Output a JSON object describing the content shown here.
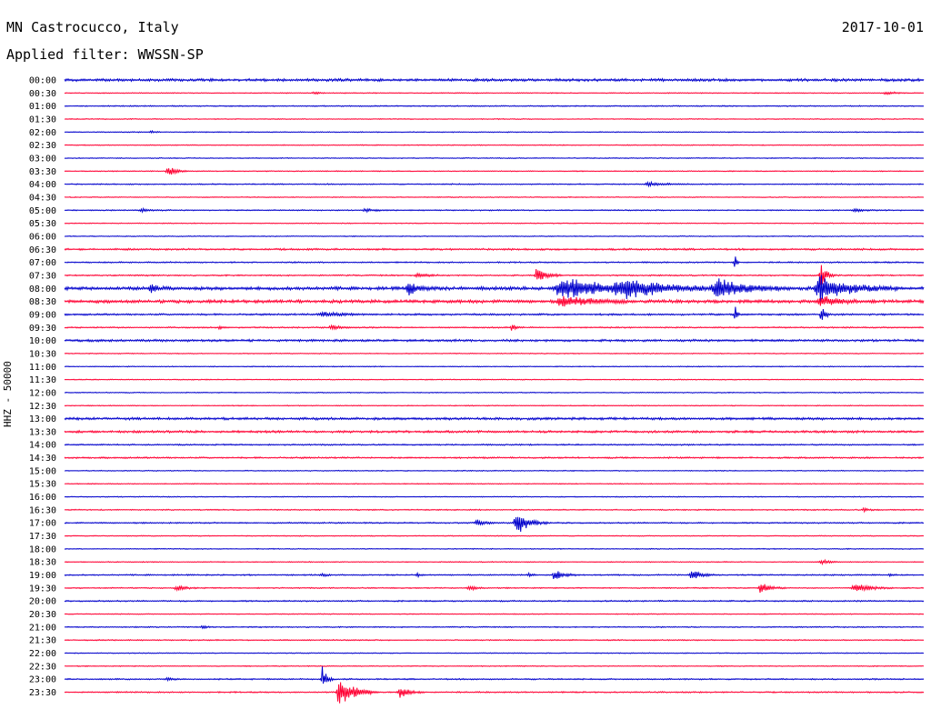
{
  "header": {
    "station": "MN Castrocucco, Italy",
    "date": "2017-10-01",
    "filter": "Applied filter: WWSSN-SP"
  },
  "chart_data": {
    "type": "line",
    "ylabel": "HHZ - 50000",
    "colors": [
      "#0000cc",
      "#ff0033"
    ],
    "rows": [
      {
        "label": "00:00",
        "noise": 1.2,
        "events": []
      },
      {
        "label": "00:30",
        "noise": 0.4,
        "events": [
          {
            "x": 0.29,
            "amp": 1.5,
            "dur": 0.005
          },
          {
            "x": 0.955,
            "amp": 2,
            "dur": 0.01
          }
        ]
      },
      {
        "label": "01:00",
        "noise": 0.5,
        "events": []
      },
      {
        "label": "01:30",
        "noise": 0.4,
        "events": []
      },
      {
        "label": "02:00",
        "noise": 0.4,
        "events": [
          {
            "x": 0.1,
            "amp": 2,
            "dur": 0.004
          }
        ]
      },
      {
        "label": "02:30",
        "noise": 0.4,
        "events": []
      },
      {
        "label": "03:00",
        "noise": 0.4,
        "events": []
      },
      {
        "label": "03:30",
        "noise": 0.4,
        "events": [
          {
            "x": 0.12,
            "amp": 6,
            "dur": 0.008
          }
        ]
      },
      {
        "label": "04:00",
        "noise": 0.5,
        "events": [
          {
            "x": 0.68,
            "amp": 2,
            "dur": 0.02
          }
        ]
      },
      {
        "label": "04:30",
        "noise": 0.4,
        "events": []
      },
      {
        "label": "05:00",
        "noise": 0.5,
        "events": [
          {
            "x": 0.09,
            "amp": 2,
            "dur": 0.01
          },
          {
            "x": 0.35,
            "amp": 2,
            "dur": 0.01
          },
          {
            "x": 0.92,
            "amp": 2,
            "dur": 0.01
          }
        ]
      },
      {
        "label": "05:30",
        "noise": 0.4,
        "events": []
      },
      {
        "label": "06:00",
        "noise": 0.4,
        "events": []
      },
      {
        "label": "06:30",
        "noise": 0.8,
        "events": []
      },
      {
        "label": "07:00",
        "noise": 0.6,
        "events": [
          {
            "x": 0.78,
            "amp": 12,
            "dur": 0.002
          }
        ]
      },
      {
        "label": "07:30",
        "noise": 0.6,
        "events": [
          {
            "x": 0.41,
            "amp": 3,
            "dur": 0.01
          },
          {
            "x": 0.55,
            "amp": 10,
            "dur": 0.01
          },
          {
            "x": 0.88,
            "amp": 14,
            "dur": 0.006
          }
        ]
      },
      {
        "label": "08:00",
        "noise": 1.5,
        "events": [
          {
            "x": 0.1,
            "amp": 6,
            "dur": 0.006
          },
          {
            "x": 0.4,
            "amp": 8,
            "dur": 0.01
          },
          {
            "x": 0.58,
            "amp": 14,
            "dur": 0.04
          },
          {
            "x": 0.65,
            "amp": 10,
            "dur": 0.05
          },
          {
            "x": 0.76,
            "amp": 10,
            "dur": 0.03
          },
          {
            "x": 0.88,
            "amp": 14,
            "dur": 0.03
          }
        ]
      },
      {
        "label": "08:30",
        "noise": 1.4,
        "events": [
          {
            "x": 0.58,
            "amp": 6,
            "dur": 0.03
          },
          {
            "x": 0.88,
            "amp": 6,
            "dur": 0.02
          }
        ]
      },
      {
        "label": "09:00",
        "noise": 0.8,
        "events": [
          {
            "x": 0.3,
            "amp": 3,
            "dur": 0.02
          },
          {
            "x": 0.78,
            "amp": 14,
            "dur": 0.002
          },
          {
            "x": 0.88,
            "amp": 12,
            "dur": 0.004
          }
        ]
      },
      {
        "label": "09:30",
        "noise": 0.6,
        "events": [
          {
            "x": 0.18,
            "amp": 2,
            "dur": 0.005
          },
          {
            "x": 0.31,
            "amp": 3,
            "dur": 0.01
          },
          {
            "x": 0.52,
            "amp": 4,
            "dur": 0.005
          }
        ]
      },
      {
        "label": "10:00",
        "noise": 1.0,
        "events": []
      },
      {
        "label": "10:30",
        "noise": 0.4,
        "events": []
      },
      {
        "label": "11:00",
        "noise": 0.4,
        "events": []
      },
      {
        "label": "11:30",
        "noise": 0.4,
        "events": []
      },
      {
        "label": "12:00",
        "noise": 0.4,
        "events": []
      },
      {
        "label": "12:30",
        "noise": 0.4,
        "events": []
      },
      {
        "label": "13:00",
        "noise": 1.1,
        "events": []
      },
      {
        "label": "13:30",
        "noise": 1.0,
        "events": []
      },
      {
        "label": "14:00",
        "noise": 0.6,
        "events": []
      },
      {
        "label": "14:30",
        "noise": 0.7,
        "events": []
      },
      {
        "label": "15:00",
        "noise": 0.4,
        "events": []
      },
      {
        "label": "15:30",
        "noise": 0.4,
        "events": []
      },
      {
        "label": "16:00",
        "noise": 0.4,
        "events": []
      },
      {
        "label": "16:30",
        "noise": 0.5,
        "events": [
          {
            "x": 0.93,
            "amp": 2,
            "dur": 0.006
          }
        ]
      },
      {
        "label": "17:00",
        "noise": 0.6,
        "events": [
          {
            "x": 0.48,
            "amp": 4,
            "dur": 0.01
          },
          {
            "x": 0.526,
            "amp": 14,
            "dur": 0.012
          }
        ]
      },
      {
        "label": "17:30",
        "noise": 0.4,
        "events": []
      },
      {
        "label": "18:00",
        "noise": 0.4,
        "events": []
      },
      {
        "label": "18:30",
        "noise": 0.4,
        "events": [
          {
            "x": 0.88,
            "amp": 3,
            "dur": 0.008
          }
        ]
      },
      {
        "label": "19:00",
        "noise": 0.6,
        "events": [
          {
            "x": 0.3,
            "amp": 2,
            "dur": 0.004
          },
          {
            "x": 0.41,
            "amp": 2,
            "dur": 0.004
          },
          {
            "x": 0.54,
            "amp": 2,
            "dur": 0.004
          },
          {
            "x": 0.57,
            "amp": 6,
            "dur": 0.01
          },
          {
            "x": 0.73,
            "amp": 6,
            "dur": 0.01
          },
          {
            "x": 0.96,
            "amp": 2,
            "dur": 0.004
          }
        ]
      },
      {
        "label": "19:30",
        "noise": 0.5,
        "events": [
          {
            "x": 0.13,
            "amp": 3,
            "dur": 0.01
          },
          {
            "x": 0.47,
            "amp": 3,
            "dur": 0.008
          },
          {
            "x": 0.81,
            "amp": 6,
            "dur": 0.01
          },
          {
            "x": 0.92,
            "amp": 6,
            "dur": 0.015
          }
        ]
      },
      {
        "label": "20:00",
        "noise": 0.6,
        "events": []
      },
      {
        "label": "20:30",
        "noise": 0.4,
        "events": []
      },
      {
        "label": "21:00",
        "noise": 0.5,
        "events": [
          {
            "x": 0.16,
            "amp": 2,
            "dur": 0.005
          }
        ]
      },
      {
        "label": "21:30",
        "noise": 0.5,
        "events": []
      },
      {
        "label": "22:00",
        "noise": 0.4,
        "events": []
      },
      {
        "label": "22:30",
        "noise": 0.4,
        "events": []
      },
      {
        "label": "23:00",
        "noise": 0.6,
        "events": [
          {
            "x": 0.12,
            "amp": 2,
            "dur": 0.005
          },
          {
            "x": 0.3,
            "amp": 16,
            "dur": 0.004
          }
        ]
      },
      {
        "label": "23:30",
        "noise": 0.6,
        "events": [
          {
            "x": 0.32,
            "amp": 18,
            "dur": 0.015
          },
          {
            "x": 0.39,
            "amp": 6,
            "dur": 0.01
          }
        ]
      }
    ]
  }
}
